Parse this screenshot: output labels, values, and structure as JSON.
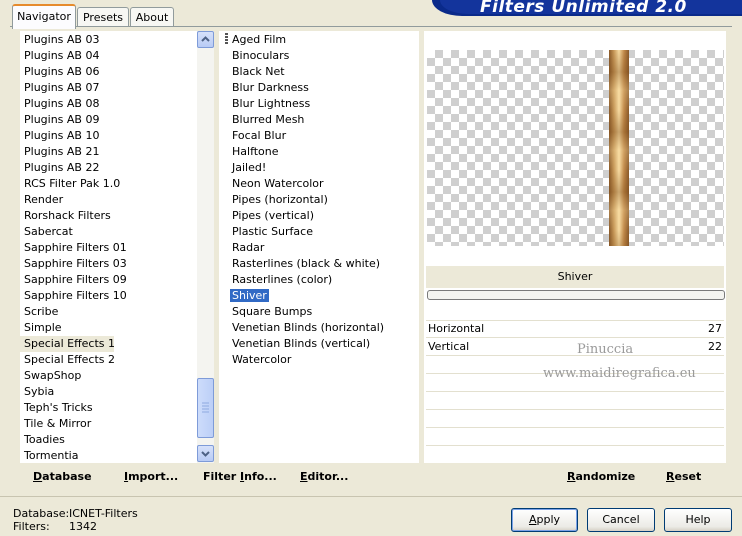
{
  "tabs": [
    "Navigator",
    "Presets",
    "About"
  ],
  "banner_title": "Filters Unlimited 2.0",
  "categories": [
    "Plugins AB 03",
    "Plugins AB 04",
    "Plugins AB 06",
    "Plugins AB 07",
    "Plugins AB 08",
    "Plugins AB 09",
    "Plugins AB 10",
    "Plugins AB 21",
    "Plugins AB 22",
    "RCS Filter Pak 1.0",
    "Render",
    "Rorshack Filters",
    "Sabercat",
    "Sapphire Filters 01",
    "Sapphire Filters 03",
    "Sapphire Filters 09",
    "Sapphire Filters 10",
    "Scribe",
    "Simple",
    "Special Effects 1",
    "Special Effects 2",
    "SwapShop",
    "Sybia",
    "Teph's Tricks",
    "Tile & Mirror",
    "Toadies",
    "Tormentia"
  ],
  "selected_category": "Special Effects 1",
  "filters": [
    "Aged Film",
    "Binoculars",
    "Black Net",
    "Blur Darkness",
    "Blur Lightness",
    "Blurred Mesh",
    "Focal Blur",
    "Halftone",
    "Jailed!",
    "Neon Watercolor",
    "Pipes (horizontal)",
    "Pipes (vertical)",
    "Plastic Surface",
    "Radar",
    "Rasterlines (black & white)",
    "Rasterlines (color)",
    "Shiver",
    "Square Bumps",
    "Venetian Blinds (horizontal)",
    "Venetian Blinds (vertical)",
    "Watercolor"
  ],
  "selected_filter": "Shiver",
  "filter_name": "Shiver",
  "params": [
    {
      "name": "Horizontal",
      "value": "27"
    },
    {
      "name": "Vertical",
      "value": "22"
    }
  ],
  "watermark": {
    "line1": "Pinuccia",
    "line2": "www.maidiregrafica.eu"
  },
  "left_buttons": [
    "Database",
    "Import...",
    "Filter Info...",
    "Editor..."
  ],
  "right_buttons": [
    "Randomize",
    "Reset"
  ],
  "status": {
    "db_label": "Database:",
    "db_value": "ICNET-Filters",
    "count_label": "Filters:",
    "count_value": "1342"
  },
  "dialog_buttons": {
    "apply": "Apply",
    "cancel": "Cancel",
    "help": "Help"
  },
  "colors": {
    "accent_tab": "#e68b2c",
    "selection": "#316ac5",
    "banner": "#13349c"
  }
}
